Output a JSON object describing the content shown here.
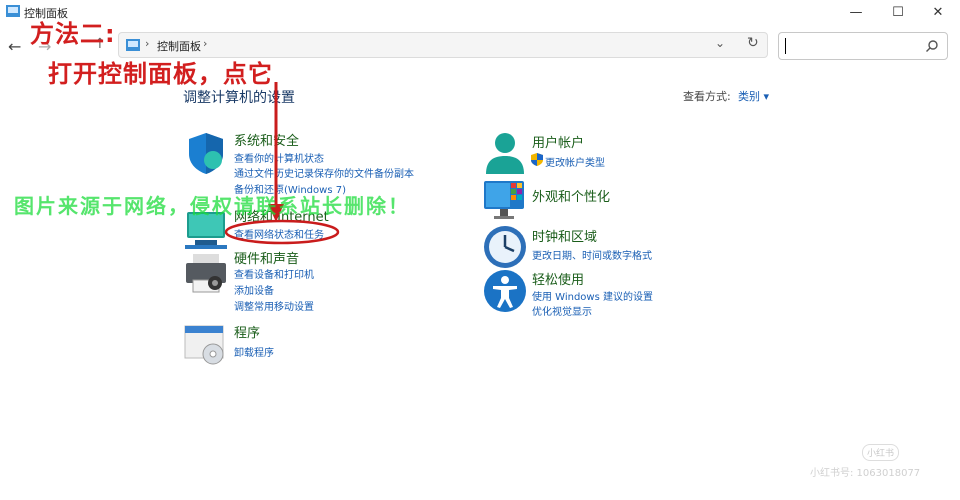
{
  "window": {
    "title": "控制面板",
    "minimize_glyph": "—",
    "maximize_glyph": "☐",
    "close_glyph": "✕"
  },
  "nav": {
    "back_glyph": "←",
    "forward_glyph": "→",
    "up_glyph": "↑",
    "separator": "›",
    "breadcrumb": "控制面板",
    "dropdown_glyph": "⌄",
    "refresh_glyph": "↻",
    "search_placeholder": ""
  },
  "header": {
    "heading": "调整计算机的设置",
    "view_by_label": "查看方式:",
    "view_by_value": "类别 ▾"
  },
  "left_categories": [
    {
      "title": "系统和安全",
      "icon": "shield-icon",
      "links": [
        "查看你的计算机状态",
        "通过文件历史记录保存你的文件备份副本",
        "备份和还原(Windows 7)"
      ]
    },
    {
      "title": "网络和 Internet",
      "icon": "network-icon",
      "links": [
        "查看网络状态和任务"
      ]
    },
    {
      "title": "硬件和声音",
      "icon": "printer-icon",
      "links": [
        "查看设备和打印机",
        "添加设备",
        "调整常用移动设置"
      ]
    },
    {
      "title": "程序",
      "icon": "programs-icon",
      "links": [
        "卸载程序"
      ]
    }
  ],
  "right_categories": [
    {
      "title": "用户帐户",
      "icon": "user-icon",
      "links": [
        "更改帐户类型"
      ]
    },
    {
      "title": "外观和个性化",
      "icon": "monitor-icon",
      "links": []
    },
    {
      "title": "时钟和区域",
      "icon": "clock-icon",
      "links": [
        "更改日期、时间或数字格式"
      ]
    },
    {
      "title": "轻松使用",
      "icon": "accessibility-icon",
      "links": [
        "使用 Windows 建议的设置",
        "优化视觉显示"
      ]
    }
  ],
  "annotation": {
    "line1": "方法二:",
    "line2": "打开控制面板，点它",
    "watermark": "图片来源于网络，侵权请联系站长删除！",
    "stamp1": "小红书",
    "stamp2": "小红书号: 1063018077"
  },
  "colors": {
    "link": "#1a5fb4",
    "category_title": "#1a5d1a",
    "annotation_red": "#d21f1f",
    "watermark_green": "#1edc3c"
  }
}
